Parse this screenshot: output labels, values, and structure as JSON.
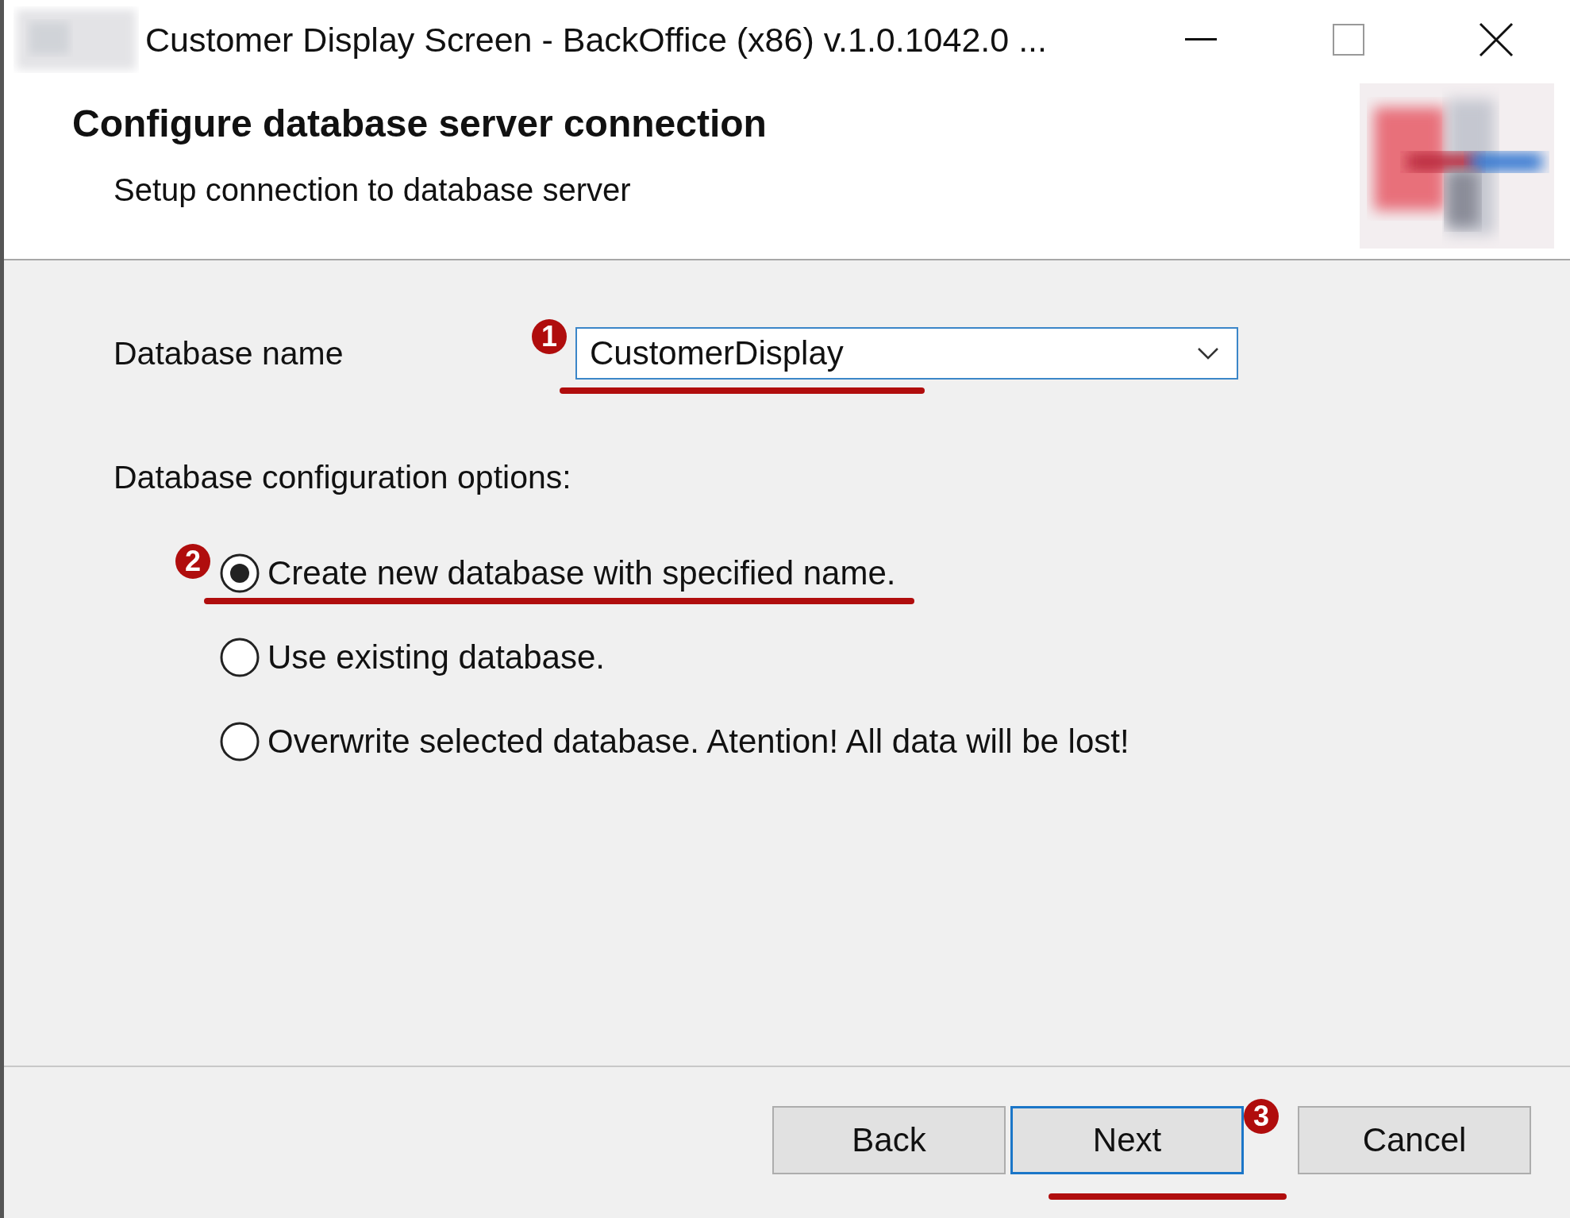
{
  "window": {
    "title": "Customer Display Screen - BackOffice (x86) v.1.0.1042.0 ..."
  },
  "header": {
    "title": "Configure database server connection",
    "subtitle": "Setup connection to database server"
  },
  "database_name": {
    "label": "Database name",
    "value": "CustomerDisplay",
    "callout": "1"
  },
  "options_label": "Database configuration options:",
  "options": [
    {
      "label": "Create new database with specified name.",
      "selected": true,
      "callout": "2"
    },
    {
      "label": "Use existing database.",
      "selected": false
    },
    {
      "label": "Overwrite selected database. Atention! All data will be lost!",
      "selected": false
    }
  ],
  "buttons": [
    {
      "label": "Back",
      "focused": false
    },
    {
      "label": "Next",
      "focused": true,
      "callout": "3"
    },
    {
      "label": "Cancel",
      "focused": false
    }
  ]
}
